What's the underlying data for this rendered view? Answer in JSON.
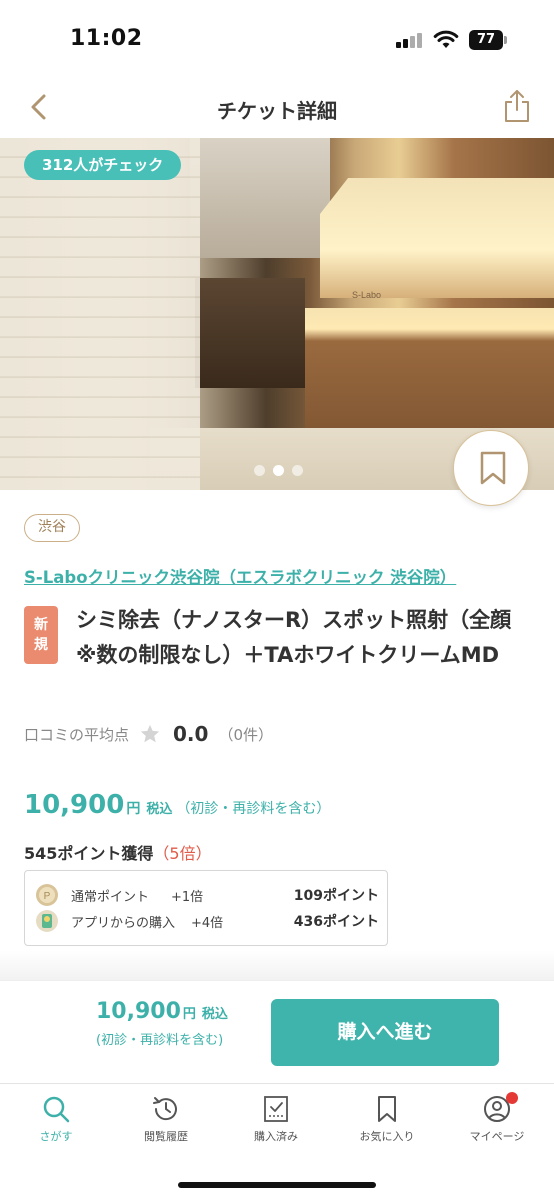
{
  "status_bar": {
    "time": "11:02",
    "battery": "77"
  },
  "nav": {
    "title": "チケット詳細",
    "back_icon": "chevron-left-icon",
    "share_icon": "share-icon"
  },
  "hero": {
    "check_badge": "312人がチェック",
    "dots_count": 3,
    "active_dot": 2,
    "bookmark_icon": "bookmark-icon",
    "sign_text": "S-Labo"
  },
  "listing": {
    "area_tag": "渋谷",
    "clinic_name": "S-Laboクリニック渋谷院（エスラボクリニック 渋谷院）",
    "new_badge": "新規",
    "title": "シミ除去（ナノスターR）スポット照射（全顔 ※数の制限なし）＋TAホワイトクリームMD",
    "review_label": "口コミの平均点",
    "review_score": "0.0",
    "review_count": "（0件）"
  },
  "price": {
    "amount": "10,900",
    "yen": "円",
    "tax": "税込",
    "note": "（初診・再診料を含む）"
  },
  "points": {
    "earned": "545ポイント獲得",
    "multiplier": "（5倍）",
    "rows": [
      {
        "name": "通常ポイント",
        "rate": "+1倍",
        "value": "109ポイント"
      },
      {
        "name": "アプリからの購入",
        "rate": "+4倍",
        "value": "436ポイント"
      }
    ]
  },
  "purchase_bar": {
    "amount": "10,900",
    "yen": "円",
    "tax": "税込",
    "note": "(初診・再診料を含む)",
    "button": "購入へ進む"
  },
  "tabs": [
    {
      "label": "さがす",
      "icon": "search-icon",
      "active": true
    },
    {
      "label": "閲覧履歴",
      "icon": "history-icon",
      "active": false
    },
    {
      "label": "購入済み",
      "icon": "purchased-icon",
      "active": false
    },
    {
      "label": "お気に入り",
      "icon": "bookmark-icon",
      "active": false
    },
    {
      "label": "マイページ",
      "icon": "user-icon",
      "active": false,
      "notification": true
    }
  ],
  "colors": {
    "accent": "#3db1a9",
    "badge_check": "#48c0b8",
    "new_badge": "#ea8a6e",
    "points_multiplier": "#e05c4a",
    "notification": "#e53935"
  }
}
